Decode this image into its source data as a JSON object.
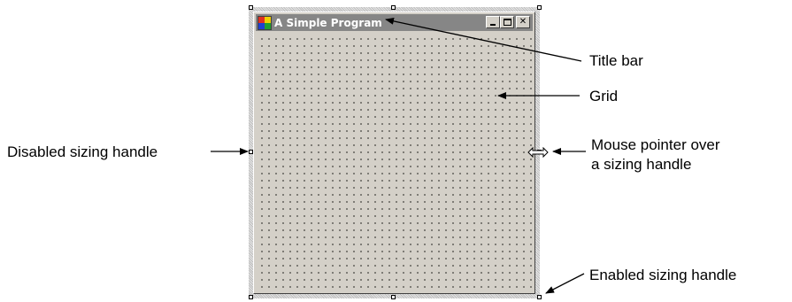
{
  "window": {
    "title": "A Simple Program",
    "caption_buttons": [
      "minimize",
      "maximize",
      "close"
    ],
    "close_glyph": "✕"
  },
  "callouts": {
    "title_bar": "Title bar",
    "grid": "Grid",
    "disabled_handle": "Disabled sizing handle",
    "mouse_pointer_line1": "Mouse pointer over",
    "mouse_pointer_line2": "a sizing handle",
    "enabled_handle": "Enabled sizing handle"
  },
  "colors": {
    "form_background": "#d4d0c8",
    "titlebar_inactive": "#868686",
    "text": "#000000"
  },
  "icons": [
    "app-icon",
    "minimize-icon",
    "maximize-icon",
    "close-icon",
    "resize-cursor-icon"
  ]
}
